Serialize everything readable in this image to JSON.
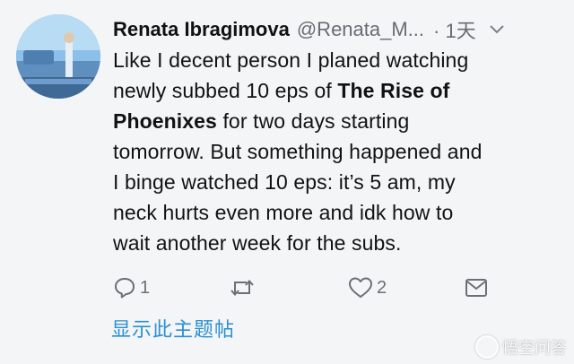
{
  "tweet": {
    "author_name": "Renata Ibragimova",
    "author_handle": "@Renata_M...",
    "time": "· 1天",
    "caret_icon": "chevron-down-icon",
    "text_lines": [
      {
        "before": "Like I decent person I planed watching",
        "bold": "",
        "after": ""
      },
      {
        "before": "newly subbed 10 eps of ",
        "bold": "The Rise of",
        "after": ""
      },
      {
        "before": "",
        "bold": "Phoenixes",
        "after": " for two days starting"
      },
      {
        "before": "tomorrow. But something happened and",
        "bold": "",
        "after": ""
      },
      {
        "before": "I binge watched 10 eps: it’s 5 am, my",
        "bold": "",
        "after": ""
      },
      {
        "before": "neck hurts even more and idk how to",
        "bold": "",
        "after": ""
      },
      {
        "before": "wait another week for the subs.",
        "bold": "",
        "after": ""
      }
    ],
    "actions": {
      "reply": {
        "icon": "reply-icon",
        "count": "1"
      },
      "retweet": {
        "icon": "retweet-icon",
        "count": ""
      },
      "like": {
        "icon": "heart-icon",
        "count": "2"
      },
      "message": {
        "icon": "envelope-icon",
        "count": ""
      }
    },
    "show_thread_label": "显示此主题帖"
  },
  "watermark": {
    "icon": "wukong-logo-icon",
    "text": "悟空问答"
  },
  "colors": {
    "background": "#f4f5f6",
    "text": "#121212",
    "secondary": "#666d73",
    "link": "#2a8fd6"
  }
}
